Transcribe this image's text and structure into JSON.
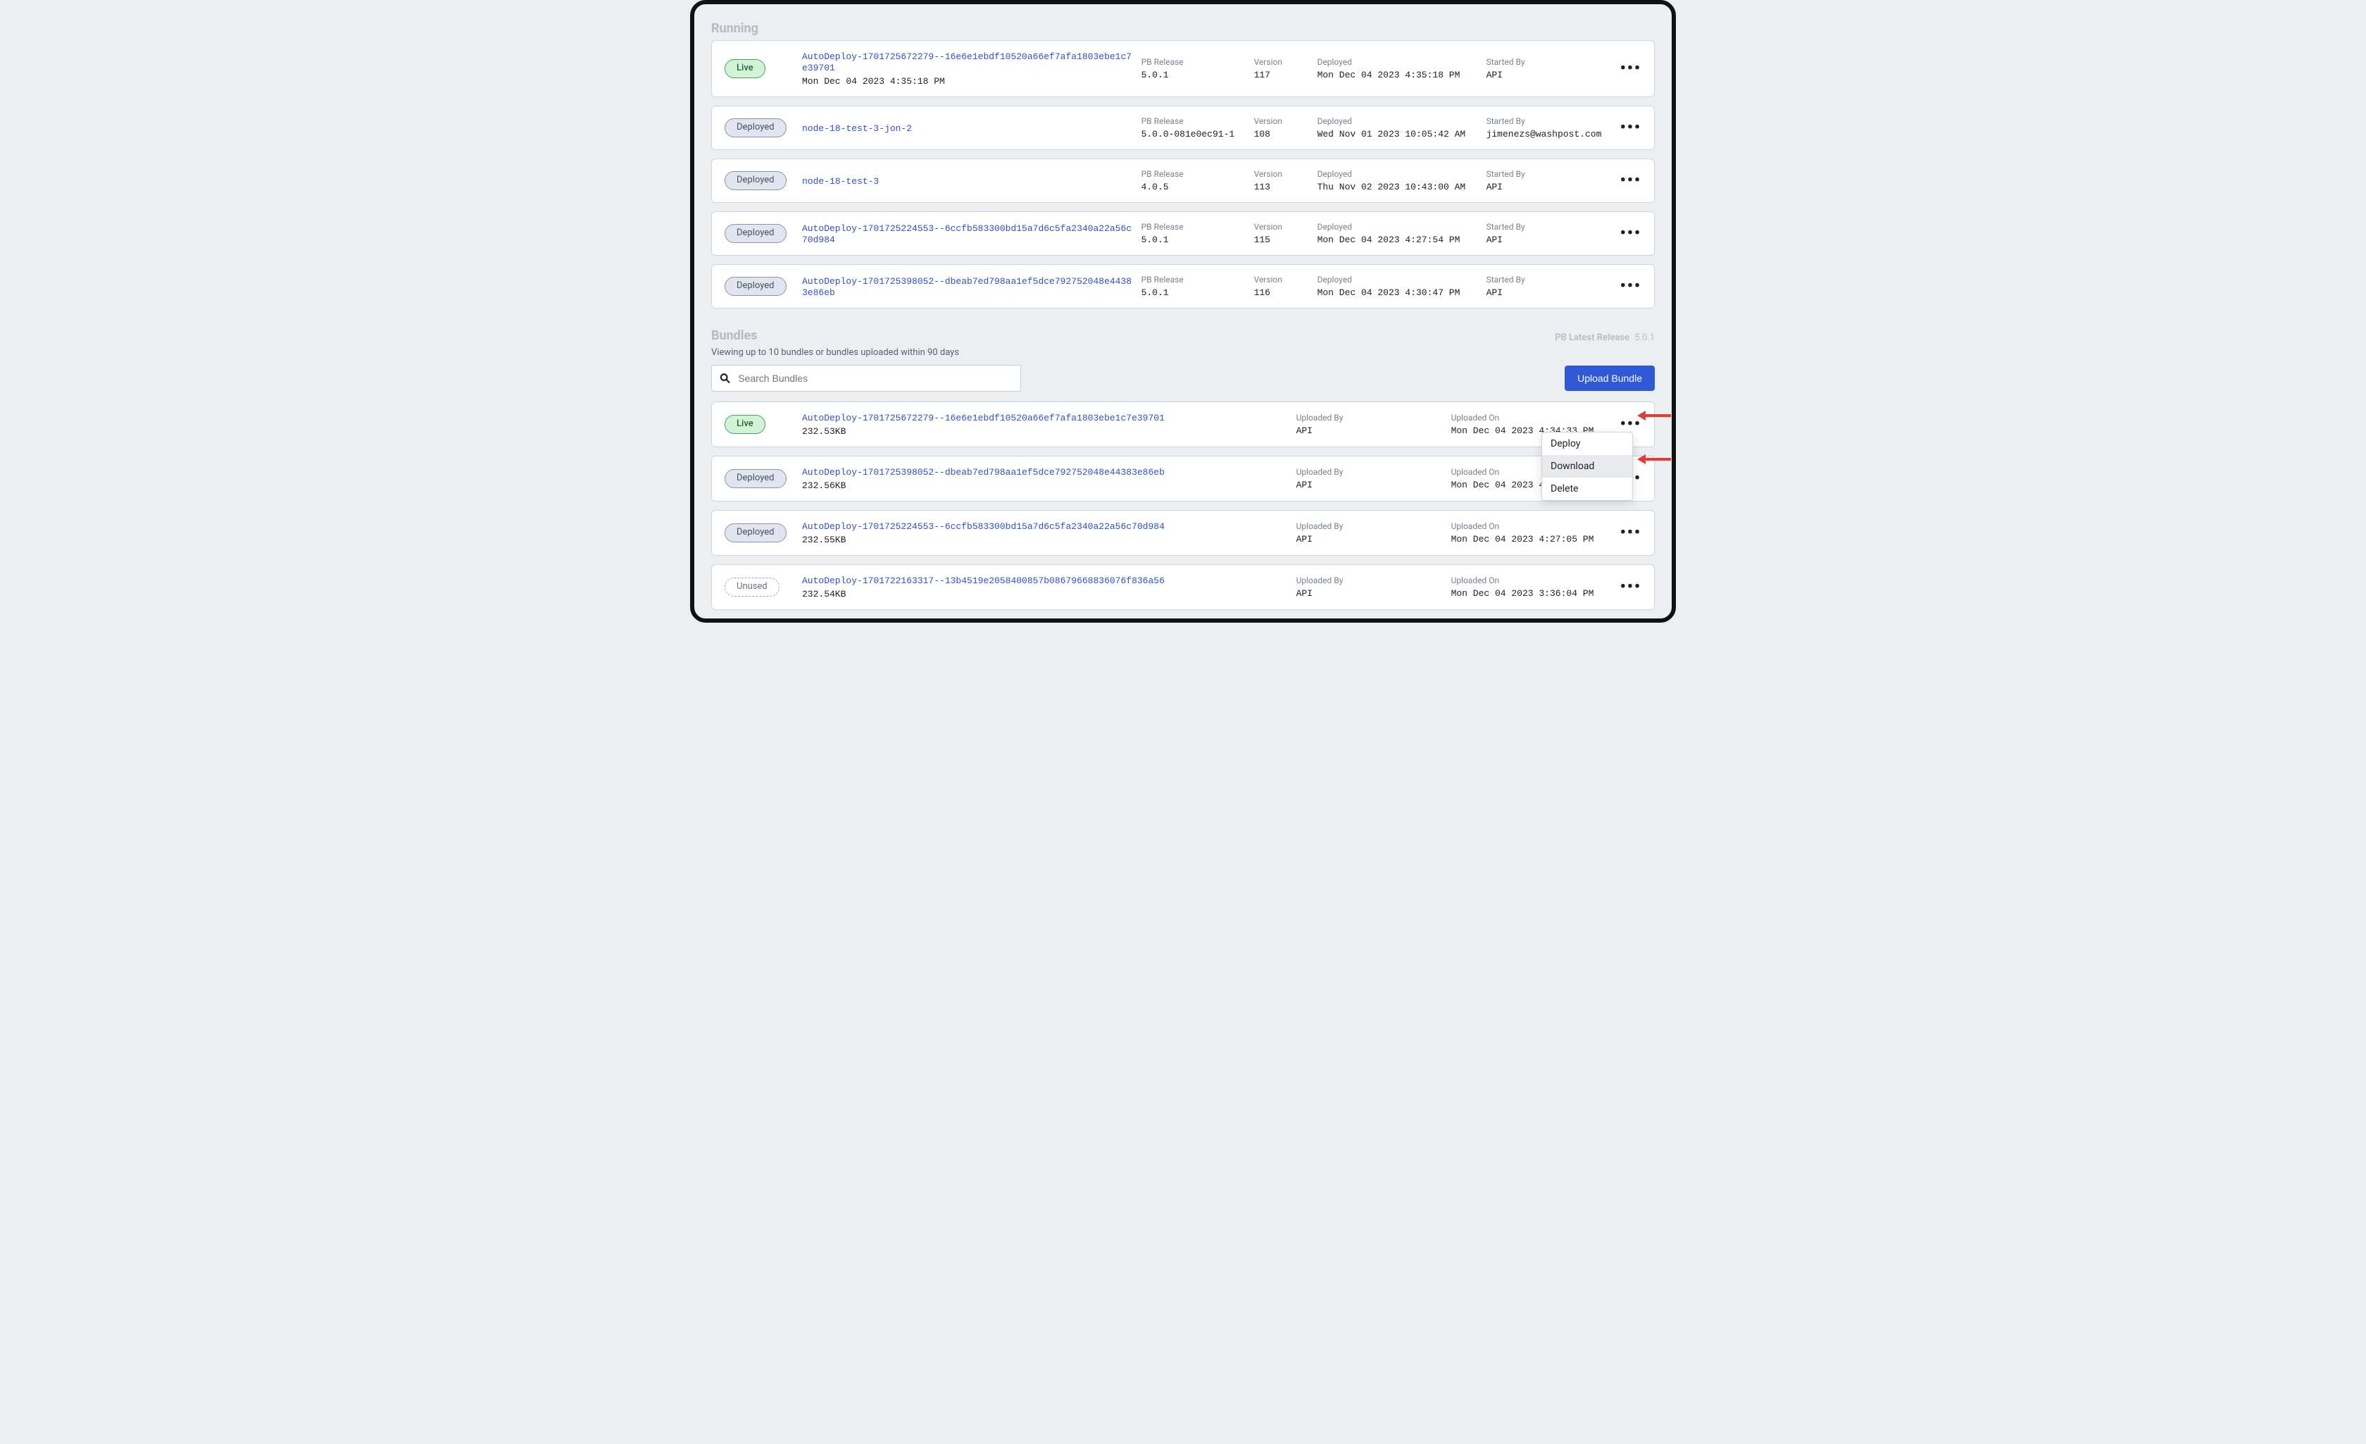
{
  "labels": {
    "running": "Running",
    "bundles": "Bundles",
    "pb_latest": "PB Latest Release",
    "pb_latest_value": "5.0.1",
    "bundle_hint": "Viewing up to 10 bundles or bundles uploaded within 90 days",
    "search_placeholder": "Search Bundles",
    "upload": "Upload Bundle",
    "pb_release": "PB Release",
    "version": "Version",
    "deployed": "Deployed",
    "started_by": "Started By",
    "uploaded_by": "Uploaded By",
    "uploaded_on": "Uploaded On"
  },
  "status": {
    "live": "Live",
    "deployed": "Deployed",
    "unused": "Unused"
  },
  "menu": {
    "deploy": "Deploy",
    "download": "Download",
    "delete": "Delete"
  },
  "running": [
    {
      "status": "live",
      "name": "AutoDeploy-1701725672279--16e6e1ebdf10520a66ef7afa1803ebe1c7e39701",
      "date": "Mon Dec 04 2023 4:35:18 PM",
      "pb": "5.0.1",
      "version": "117",
      "deployed": "Mon Dec 04 2023 4:35:18 PM",
      "started_by": "API"
    },
    {
      "status": "deployed",
      "name": "node-18-test-3-jon-2",
      "date": "",
      "pb": "5.0.0-081e0ec91-1",
      "version": "108",
      "deployed": "Wed Nov 01 2023 10:05:42 AM",
      "started_by": "jimenezs@washpost.com"
    },
    {
      "status": "deployed",
      "name": "node-18-test-3",
      "date": "",
      "pb": "4.0.5",
      "version": "113",
      "deployed": "Thu Nov 02 2023 10:43:00 AM",
      "started_by": "API"
    },
    {
      "status": "deployed",
      "name": "AutoDeploy-1701725224553--6ccfb583300bd15a7d6c5fa2340a22a56c70d984",
      "date": "",
      "pb": "5.0.1",
      "version": "115",
      "deployed": "Mon Dec 04 2023 4:27:54 PM",
      "started_by": "API"
    },
    {
      "status": "deployed",
      "name": "AutoDeploy-1701725398052--dbeab7ed798aa1ef5dce792752048e44383e86eb",
      "date": "",
      "pb": "5.0.1",
      "version": "116",
      "deployed": "Mon Dec 04 2023 4:30:47 PM",
      "started_by": "API"
    }
  ],
  "bundles": [
    {
      "status": "live",
      "name": "AutoDeploy-1701725672279--16e6e1ebdf10520a66ef7afa1803ebe1c7e39701",
      "size": "232.53KB",
      "uploaded_by": "API",
      "uploaded_on": "Mon Dec 04 2023 4:34:33 PM",
      "show_menu": true
    },
    {
      "status": "deployed",
      "name": "AutoDeploy-1701725398052--dbeab7ed798aa1ef5dce792752048e44383e86eb",
      "size": "232.56KB",
      "uploaded_by": "API",
      "uploaded_on": "Mon Dec 04 2023 4:29:"
    },
    {
      "status": "deployed",
      "name": "AutoDeploy-1701725224553--6ccfb583300bd15a7d6c5fa2340a22a56c70d984",
      "size": "232.55KB",
      "uploaded_by": "API",
      "uploaded_on": "Mon Dec 04 2023 4:27:05 PM"
    },
    {
      "status": "unused",
      "name": "AutoDeploy-1701722163317--13b4519e2058400857b08679668836076f836a56",
      "size": "232.54KB",
      "uploaded_by": "API",
      "uploaded_on": "Mon Dec 04 2023 3:36:04 PM"
    }
  ]
}
